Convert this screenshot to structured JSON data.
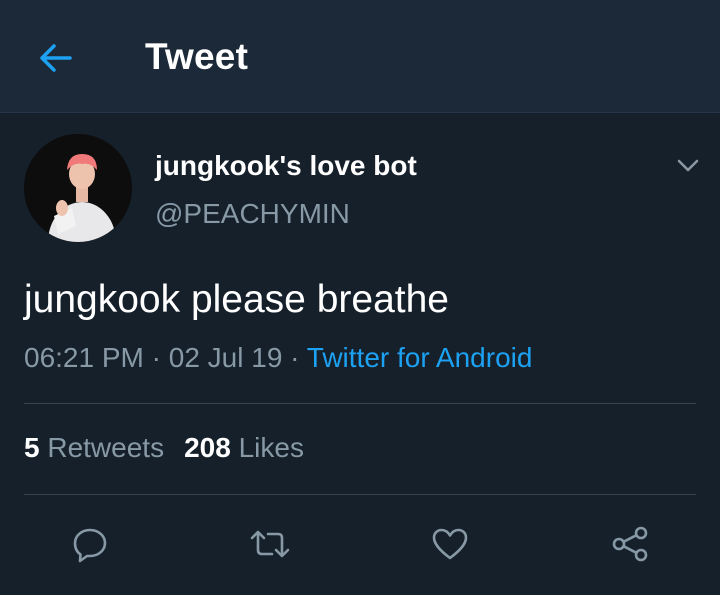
{
  "header": {
    "title": "Tweet",
    "back_icon": "arrow-left-icon"
  },
  "tweet": {
    "display_name": "jungkook's love bot",
    "handle": "@PEACHYMIN",
    "text": "jungkook please breathe",
    "time": "06:21 PM",
    "separator": "·",
    "date": "02 Jul 19",
    "source": "Twitter for Android"
  },
  "stats": {
    "retweets_count": "5",
    "retweets_label": "Retweets",
    "likes_count": "208",
    "likes_label": "Likes"
  },
  "actions": [
    "reply-icon",
    "retweet-icon",
    "like-icon",
    "share-icon"
  ],
  "colors": {
    "background": "#15202b",
    "header": "#1c2938",
    "accent": "#1da1f2",
    "secondary_text": "#8899a6",
    "divider": "#38444d"
  }
}
